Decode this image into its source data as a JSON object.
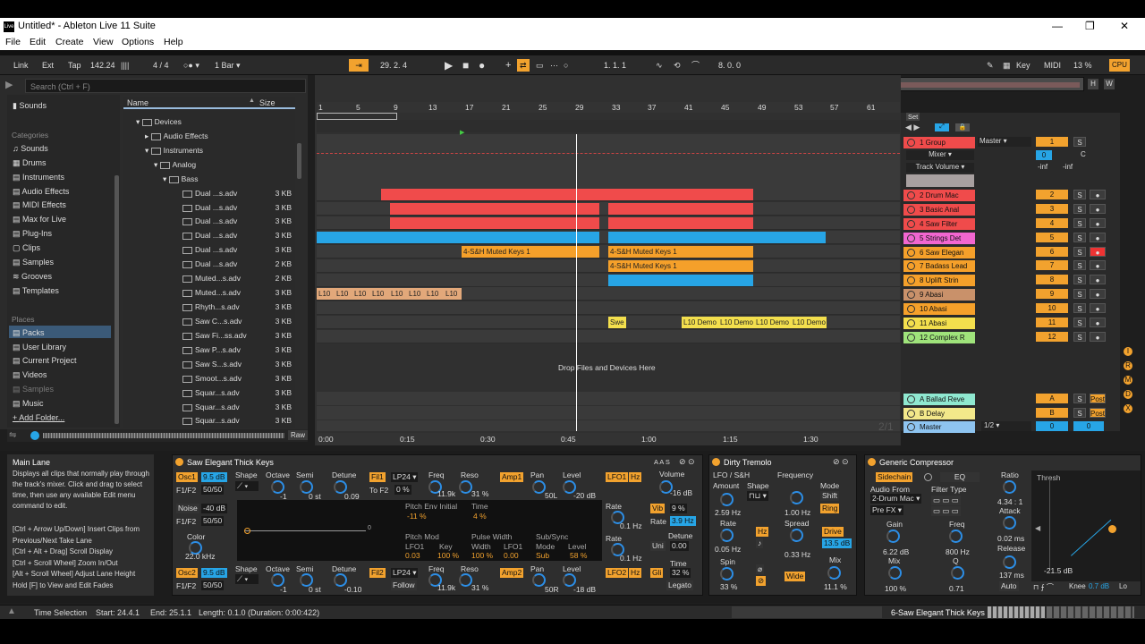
{
  "window": {
    "title": "Untitled* - Ableton Live 11 Suite",
    "logo": "Live",
    "minimize": "—",
    "restore": "❐",
    "close": "✕"
  },
  "menu": [
    "File",
    "Edit",
    "Create",
    "View",
    "Options",
    "Help"
  ],
  "control": {
    "link": "Link",
    "ext": "Ext",
    "tap": "Tap",
    "tempo": "142.24",
    "meter_icon": "||||",
    "sig": "4 / 4",
    "metro": "○● ▾",
    "quant": "1 Bar ▾",
    "position": "29.  2.  4",
    "loop_start": "1.  1.  1",
    "loop_len": "8.  0.  0",
    "key": "Key",
    "midi": "MIDI",
    "cpu_pct": "13 %",
    "cpu": "CPU"
  },
  "browser": {
    "search_placeholder": "Search (Ctrl + F)",
    "collections": [
      "Sounds"
    ],
    "categories_header": "Categories",
    "categories": [
      "Sounds",
      "Drums",
      "Instruments",
      "Audio Effects",
      "MIDI Effects",
      "Max for Live",
      "Plug-Ins",
      "Clips",
      "Samples",
      "Grooves",
      "Templates"
    ],
    "places_header": "Places",
    "places": [
      "Packs",
      "User Library",
      "Current Project",
      "Videos",
      "Samples",
      "Music",
      "Add Folder..."
    ],
    "col_name": "Name",
    "col_size": "Size",
    "tree": [
      {
        "name": "Devices",
        "size": "",
        "indent": 1
      },
      {
        "name": "Audio Effects",
        "size": "",
        "indent": 2
      },
      {
        "name": "Instruments",
        "size": "",
        "indent": 2
      },
      {
        "name": "Analog",
        "size": "",
        "indent": 3
      },
      {
        "name": "Bass",
        "size": "",
        "indent": 4
      }
    ],
    "files": [
      {
        "name": "Dual ...s.adv",
        "size": "3 KB"
      },
      {
        "name": "Dual ...s.adv",
        "size": "3 KB"
      },
      {
        "name": "Dual ...s.adv",
        "size": "3 KB"
      },
      {
        "name": "Dual ...s.adv",
        "size": "3 KB"
      },
      {
        "name": "Dual ...s.adv",
        "size": "3 KB"
      },
      {
        "name": "Dual ...s.adv",
        "size": "2 KB"
      },
      {
        "name": "Muted...s.adv",
        "size": "2 KB"
      },
      {
        "name": "Muted...s.adv",
        "size": "3 KB"
      },
      {
        "name": "Rhyth...s.adv",
        "size": "3 KB"
      },
      {
        "name": "Saw C...s.adv",
        "size": "3 KB"
      },
      {
        "name": "Saw Fi...ss.adv",
        "size": "3 KB"
      },
      {
        "name": "Saw P...s.adv",
        "size": "3 KB"
      },
      {
        "name": "Saw S...s.adv",
        "size": "3 KB"
      },
      {
        "name": "Smoot...s.adv",
        "size": "3 KB"
      },
      {
        "name": "Squar...s.adv",
        "size": "3 KB"
      },
      {
        "name": "Squar...s.adv",
        "size": "3 KB"
      },
      {
        "name": "Squar...s.adv",
        "size": "3 KB"
      }
    ],
    "raw": "Raw"
  },
  "ruler": [
    "1",
    "5",
    "9",
    "13",
    "17",
    "21",
    "25",
    "29",
    "33",
    "37",
    "41",
    "45",
    "49",
    "53",
    "57",
    "61"
  ],
  "time_ruler": [
    "0:00",
    "0:15",
    "0:30",
    "0:45",
    "1:00",
    "1:15",
    "1:30"
  ],
  "clips": {
    "muted_keys": "4-S&H Muted Keys 1",
    "l10": "L10",
    "swe": "Swe",
    "demo": "L10 Demo"
  },
  "drop_hint": "Drop Files and Devices Here",
  "overlay_label": "2/1",
  "tracks": [
    {
      "name": "1 Group",
      "color": "#f04b4b",
      "num": "1"
    },
    {
      "name": "2 Drum Mac",
      "color": "#f04b4b",
      "num": "2"
    },
    {
      "name": "3 Basic Anal",
      "color": "#f04b4b",
      "num": "3"
    },
    {
      "name": "4 Saw Filter",
      "color": "#f04b4b",
      "num": "4"
    },
    {
      "name": "5 Strings Det",
      "color": "#f266d0",
      "num": "5"
    },
    {
      "name": "6 Saw Elegan",
      "color": "#f5a02a",
      "num": "6"
    },
    {
      "name": "7 Badass Lead",
      "color": "#f5a02a",
      "num": "7"
    },
    {
      "name": "8 Uplift Strin",
      "color": "#f5a02a",
      "num": "8"
    },
    {
      "name": "9 Abasi",
      "color": "#c9916a",
      "num": "9"
    },
    {
      "name": "10 Abasi",
      "color": "#f5a02a",
      "num": "10"
    },
    {
      "name": "11 Abasi",
      "color": "#f3df4d",
      "num": "11"
    },
    {
      "name": "12 Complex R",
      "color": "#9fe37b",
      "num": "12"
    }
  ],
  "returns": [
    {
      "name": "A Ballad Reve",
      "color": "#8fe8d0",
      "num": "A",
      "post": "Post"
    },
    {
      "name": "B Delay",
      "color": "#f3e88a",
      "num": "B",
      "post": "Post"
    }
  ],
  "master": {
    "name": "Master",
    "num": "0",
    "num2": "0",
    "route": "1/2 ▾"
  },
  "group_io": {
    "out": "Master ▾",
    "mixer": "Mixer ▾",
    "param": "Track Volume ▾",
    "c": "C",
    "inf1": "-inf",
    "inf2": "-inf",
    "s": "S",
    "set": "Set"
  },
  "info": {
    "title": "Main Lane",
    "body": "Displays all clips that normally play through the track's mixer. Click and drag to select time, then use any available Edit menu command to edit.",
    "shortcuts": "[Ctrl + Arrow Up/Down] Insert Clips from Previous/Next Take Lane\n[Ctrl + Alt + Drag] Scroll Display\n[Ctrl + Scroll Wheel] Zoom In/Out\n[Alt + Scroll Wheel] Adjust Lane Height\nHold [F] to View and Edit Fades"
  },
  "synth": {
    "title": "Saw Elegant Thick Keys",
    "osc1": "Osc1",
    "osc1_vol": "9.5 dB",
    "f1f2": "F1/F2",
    "ratio": "50/50",
    "shape": "Shape",
    "octave": "Octave",
    "oct1": "-1",
    "semi": "Semi",
    "semi1": "0 st",
    "detune": "Detune",
    "det1": "0.09",
    "fil1": "Fil1",
    "lp24": "LP24 ▾",
    "tof2": "To F2",
    "tof2v": "0 %",
    "freq": "Freq",
    "freq1": "11.9k",
    "reso": "Reso",
    "reso1": "31 %",
    "amp1": "Amp1",
    "pan": "Pan",
    "pan1": "50L",
    "level": "Level",
    "level1": "-20 dB",
    "lfo1": "LFO1",
    "hz": "Hz",
    "volume": "Volume",
    "volv": "-16 dB",
    "vib": "Vib",
    "vibv": "9 %",
    "rate": "Rate",
    "ratev": "3.9 Hz",
    "uni": "Uni",
    "detune2": "0.00",
    "gli": "Gli",
    "gliv": "32 %",
    "time": "Time",
    "legato": "Legato",
    "noise": "Noise",
    "noisev": "-40 dB",
    "noise_ratio": "50/50",
    "color": "Color",
    "colorv": "22.0 kHz",
    "pitch_env": "Pitch Env Initial",
    "pe_v": "-11 %",
    "time_l": "Time",
    "time_v": "4 %",
    "pitch_mod": "Pitch Mod",
    "lfo1_l": "LFO1",
    "lfo1_v": "0.03",
    "key": "Key",
    "key_v": "100 %",
    "pulse": "Pulse Width",
    "width": "Width",
    "width_v": "100 %",
    "lfo1b": "LFO1",
    "lfo1b_v": "0.00",
    "sub": "Sub/Sync",
    "mode": "Mode",
    "mode_v": "Sub",
    "lvl": "Level",
    "lvl_v": "58 %",
    "rate1": "0.1 Hz",
    "rate2": "0.1 Hz",
    "osc2": "Osc2",
    "osc2_vol": "9.5 dB",
    "oct2": "-1",
    "semi2": "0 st",
    "det2": "-0.10",
    "fil2": "Fil2",
    "follow": "Follow",
    "freq2": "11.9k",
    "reso2": "31 %",
    "amp2": "Amp2",
    "pan2": "50R",
    "level2": "-18 dB",
    "lfo2": "LFO2",
    "graph_zero": "0",
    "aas": "A A S"
  },
  "tremolo": {
    "title": "Dirty Tremolo",
    "lfo": "LFO / S&H",
    "amount": "Amount",
    "amount_v": "2.59 Hz",
    "shape": "Shape",
    "frequency": "Frequency",
    "freq_v": "1.00 Hz",
    "mode": "Mode",
    "shift": "Shift",
    "ring": "Ring",
    "rate": "Rate",
    "rate_v": "0.05 Hz",
    "hz": "Hz",
    "spread": "Spread",
    "spread_v": "0.33 Hz",
    "drive": "Drive",
    "drive_v": "13.5 dB",
    "spin": "Spin",
    "spin_v": "33 %",
    "wide": "Wide",
    "mix": "Mix",
    "mix_v": "11.1 %"
  },
  "comp": {
    "title": "Generic Compressor",
    "sidechain": "Sidechain",
    "eq": "EQ",
    "audio_from": "Audio From",
    "src": "2-Drum Mac ▾",
    "prefx": "Pre FX ▾",
    "filter_type": "Filter Type",
    "gain": "Gain",
    "gain_v": "6.22 dB",
    "freq": "Freq",
    "freq_v": "800 Hz",
    "mix": "Mix",
    "mix_v": "100 %",
    "q": "Q",
    "q_v": "0.71",
    "ratio": "Ratio",
    "ratio_v": "4.34 : 1",
    "attack": "Attack",
    "attack_v": "0.02 ms",
    "release": "Release",
    "release_v": "137 ms",
    "auto": "Auto",
    "thresh": "Thresh",
    "thresh_v": "-21.5 dB",
    "knee": "Knee",
    "knee_v": "0.7 dB",
    "lo": "Lo"
  },
  "status": {
    "mode": "Time Selection",
    "start": "Start: 24.4.1",
    "end": "End: 25.1.1",
    "length": "Length: 0.1.0  (Duration: 0:00:422)",
    "track": "6-Saw Elegant Thick Keys"
  }
}
